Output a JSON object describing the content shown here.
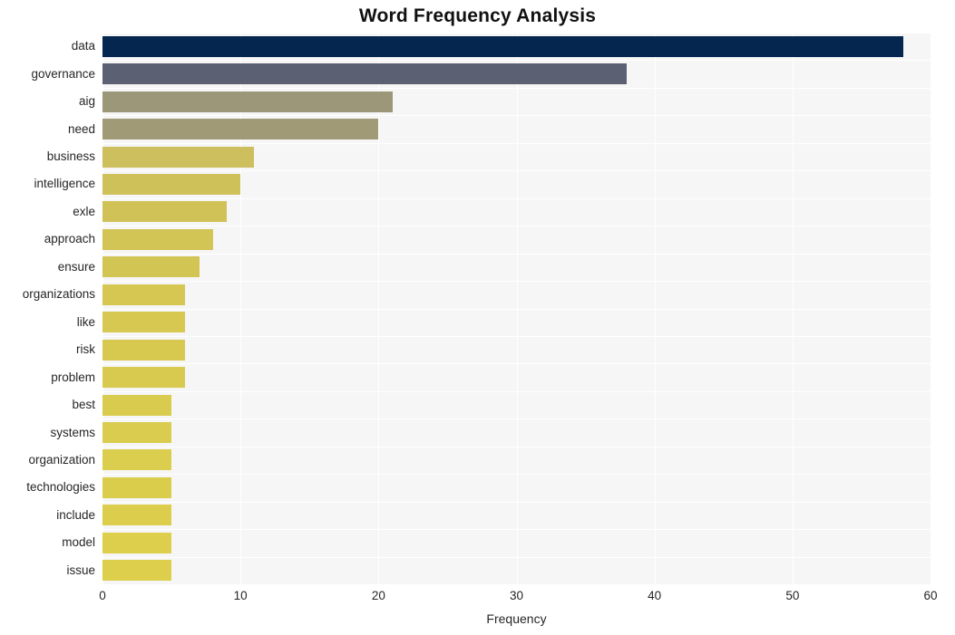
{
  "chart_data": {
    "type": "bar",
    "orientation": "horizontal",
    "title": "Word Frequency Analysis",
    "xlabel": "Frequency",
    "ylabel": "",
    "xlim": [
      0,
      60
    ],
    "xticks": [
      0,
      10,
      20,
      30,
      40,
      50,
      60
    ],
    "xtick_labels": [
      "0",
      "10",
      "20",
      "30",
      "40",
      "50",
      "60"
    ],
    "grid": true,
    "legend": "none",
    "categories": [
      "data",
      "governance",
      "aig",
      "need",
      "business",
      "intelligence",
      "exle",
      "approach",
      "ensure",
      "organizations",
      "like",
      "risk",
      "problem",
      "best",
      "systems",
      "organization",
      "technologies",
      "include",
      "model",
      "issue"
    ],
    "values": [
      58,
      38,
      21,
      20,
      11,
      10,
      9,
      8,
      7,
      6,
      6,
      6,
      6,
      5,
      5,
      5,
      5,
      5,
      5,
      5
    ],
    "bar_colors": [
      "#04264f",
      "#5b6173",
      "#9d977a",
      "#a09a77",
      "#cdbf5d",
      "#cfc159",
      "#d0c257",
      "#d2c455",
      "#d3c553",
      "#d5c752",
      "#d6c851",
      "#d7c950",
      "#d8ca4f",
      "#d9cb4e",
      "#dacc4e",
      "#dbcd4d",
      "#dbcd4c",
      "#dcce4c",
      "#ddcf4b",
      "#ddcf4b"
    ],
    "plot_background": "#f6f6f7",
    "gridline_color": "#ffffff",
    "figure_background": "#ffffff"
  }
}
